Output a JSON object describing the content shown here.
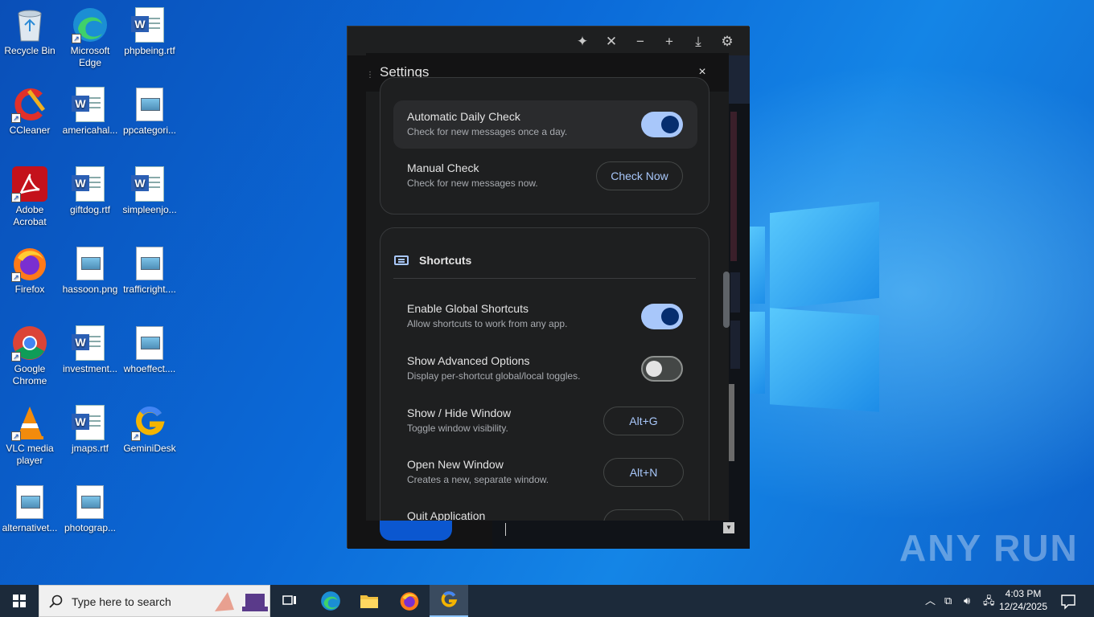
{
  "desktop": {
    "icons": [
      {
        "label": "Recycle Bin",
        "icon": "recycle-bin-icon"
      },
      {
        "label": "Microsoft Edge",
        "icon": "edge-icon"
      },
      {
        "label": "phpbeing.rtf",
        "icon": "word-doc-icon"
      },
      {
        "label": "CCleaner",
        "icon": "ccleaner-icon"
      },
      {
        "label": "americahal...",
        "icon": "word-doc-icon"
      },
      {
        "label": "ppcategori...",
        "icon": "image-file-icon"
      },
      {
        "label": "Adobe Acrobat",
        "icon": "acrobat-icon"
      },
      {
        "label": "giftdog.rtf",
        "icon": "word-doc-icon"
      },
      {
        "label": "simpleenjo...",
        "icon": "word-doc-icon"
      },
      {
        "label": "Firefox",
        "icon": "firefox-icon"
      },
      {
        "label": "hassoon.png",
        "icon": "image-file-icon"
      },
      {
        "label": "trafficright....",
        "icon": "image-file-icon"
      },
      {
        "label": "Google Chrome",
        "icon": "chrome-icon"
      },
      {
        "label": "investment...",
        "icon": "word-doc-icon"
      },
      {
        "label": "whoeffect....",
        "icon": "image-file-icon"
      },
      {
        "label": "VLC media player",
        "icon": "vlc-icon"
      },
      {
        "label": "jmaps.rtf",
        "icon": "word-doc-icon"
      },
      {
        "label": "GeminiDesk",
        "icon": "geminidesk-icon"
      },
      {
        "label": "alternativet...",
        "icon": "image-file-icon"
      },
      {
        "label": "photograp...",
        "icon": "image-file-icon"
      }
    ]
  },
  "app": {
    "toolbar_icons": [
      "sparkle-icon",
      "close-icon",
      "minimize-icon",
      "add-icon",
      "download-icon",
      "gear-icon"
    ]
  },
  "settings": {
    "title": "Settings",
    "close_glyph": "×",
    "updates": {
      "auto_title": "Automatic Daily Check",
      "auto_sub": "Check for new messages once a day.",
      "auto_on": true,
      "manual_title": "Manual Check",
      "manual_sub": "Check for new messages now.",
      "manual_button": "Check Now"
    },
    "shortcuts": {
      "heading": "Shortcuts",
      "items": [
        {
          "title": "Enable Global Shortcuts",
          "sub": "Allow shortcuts to work from any app.",
          "type": "toggle",
          "on": true
        },
        {
          "title": "Show Advanced Options",
          "sub": "Display per-shortcut global/local toggles.",
          "type": "toggle",
          "on": false
        },
        {
          "title": "Show / Hide Window",
          "sub": "Toggle window visibility.",
          "type": "key",
          "key": "Alt+G"
        },
        {
          "title": "Open New Window",
          "sub": "Creates a new, separate window.",
          "type": "key",
          "key": "Alt+N"
        },
        {
          "title": "Quit Application",
          "sub": "",
          "type": "key",
          "key": ""
        }
      ]
    }
  },
  "watermark": "ANY RUN",
  "taskbar": {
    "search_placeholder": "Type here to search",
    "apps": [
      "task-view-icon",
      "edge-icon",
      "file-explorer-icon",
      "firefox-icon",
      "geminidesk-icon"
    ],
    "time": "4:03 PM",
    "date": "12/24/2025"
  },
  "colors": {
    "accent": "#a8c7fa",
    "toggle_knob_on": "#062e6f",
    "dialog_bg": "#1b1c1d",
    "taskbar_bg": "#1c2a3a"
  }
}
